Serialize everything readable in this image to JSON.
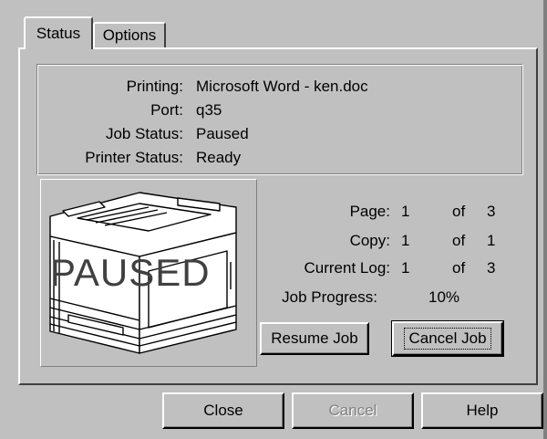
{
  "tabs": [
    {
      "label": "Status",
      "active": true
    },
    {
      "label": "Options",
      "active": false
    }
  ],
  "info": {
    "printing_label": "Printing:",
    "printing_value": "Microsoft Word - ken.doc",
    "port_label": "Port:",
    "port_value": "q35",
    "job_status_label": "Job Status:",
    "job_status_value": "Paused",
    "printer_status_label": "Printer Status:",
    "printer_status_value": "Ready"
  },
  "printer_image": {
    "icon": "printer-icon",
    "overlay_text": "PAUSED"
  },
  "stats": {
    "page_label": "Page:",
    "page_current": "1",
    "page_of": "of",
    "page_total": "3",
    "copy_label": "Copy:",
    "copy_current": "1",
    "copy_of": "of",
    "copy_total": "1",
    "log_label": "Current Log:",
    "log_current": "1",
    "log_of": "of",
    "log_total": "3",
    "progress_label": "Job Progress:",
    "progress_value": "10%"
  },
  "job_buttons": {
    "resume": "Resume Job",
    "cancel_job": "Cancel Job"
  },
  "dialog_buttons": {
    "close": "Close",
    "cancel": "Cancel",
    "help": "Help"
  },
  "colors": {
    "face": "#c0c0c0",
    "highlight": "#ffffff",
    "shadow": "#808080",
    "disabled_text": "#808080"
  }
}
